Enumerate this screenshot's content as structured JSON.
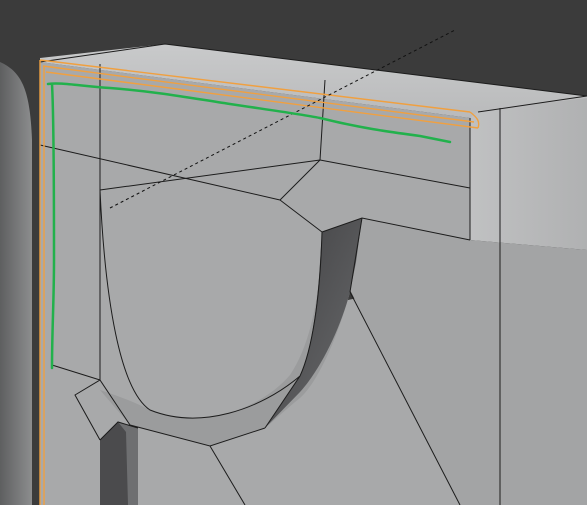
{
  "viewport": {
    "name": "3d-viewport",
    "background_color": "#3b3b3b",
    "mesh_color": "#a8a9aa",
    "mesh_face_light": "#b4b5b6",
    "mesh_top_color": "#c3c4c5",
    "wire_color": "#1c1c1c",
    "selected_edge_color": "#f0a040",
    "annotation_color": "#22b14c",
    "hole_inner_color": "#5a5a5c"
  },
  "objects": {
    "background_mesh": "grey-background-mesh",
    "main_mesh": "beveled-box-mesh",
    "cutout": "circular-cutout",
    "slot": "vertical-slot",
    "selection": "selected-edge-loop",
    "annotation": "green-pencil-stroke",
    "guide": "dashed-guide-line"
  }
}
